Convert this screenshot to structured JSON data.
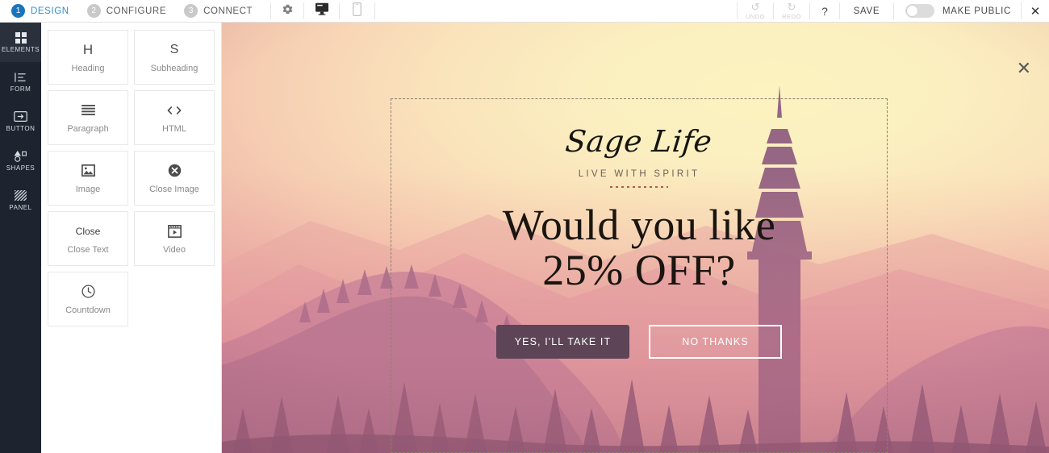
{
  "topbar": {
    "steps": [
      {
        "num": "1",
        "label": "DESIGN",
        "active": true
      },
      {
        "num": "2",
        "label": "CONFIGURE",
        "active": false
      },
      {
        "num": "3",
        "label": "CONNECT",
        "active": false
      }
    ],
    "settings_icon": "gear-icon",
    "desktop_icon": "desktop-icon",
    "mobile_icon": "mobile-icon",
    "undo_label": "UNDO",
    "redo_label": "REDO",
    "help_label": "?",
    "save_label": "SAVE",
    "make_public_label": "MAKE PUBLIC",
    "make_public_on": false,
    "close_label": "✕",
    "accent_color": "#1b75bb"
  },
  "rail": {
    "items": [
      {
        "label": "ELEMENTS",
        "icon": "grid-icon",
        "active": true
      },
      {
        "label": "FORM",
        "icon": "form-list-icon",
        "active": false
      },
      {
        "label": "BUTTON",
        "icon": "button-icon",
        "active": false
      },
      {
        "label": "SHAPES",
        "icon": "shapes-icon",
        "active": false
      },
      {
        "label": "PANEL",
        "icon": "panel-icon",
        "active": false
      }
    ],
    "background_color": "#1d2430"
  },
  "panel": {
    "cards": [
      {
        "glyph": "H",
        "label": "Heading",
        "icon": "heading-icon"
      },
      {
        "glyph": "S",
        "label": "Subheading",
        "icon": "subheading-icon"
      },
      {
        "glyph": "☰",
        "label": "Paragraph",
        "icon": "paragraph-icon"
      },
      {
        "glyph": "<>",
        "label": "HTML",
        "icon": "html-code-icon"
      },
      {
        "glyph": "Ὓc",
        "label": "Image",
        "icon": "image-icon"
      },
      {
        "glyph": "✖",
        "label": "Close Image",
        "icon": "close-image-icon"
      },
      {
        "glyph": "Close",
        "label": "Close Text",
        "icon": "close-text-icon"
      },
      {
        "glyph": "▶",
        "label": "Video",
        "icon": "video-icon"
      },
      {
        "glyph": "◴",
        "label": "Countdown",
        "icon": "countdown-clock-icon"
      }
    ]
  },
  "canvas": {
    "close_label": "✕",
    "popup": {
      "brand": "Sage Life",
      "tagline": "LIVE WITH SPIRIT",
      "headline_line1": "Would you like",
      "headline_line2": "25% OFF?",
      "primary_button": "YES, I'LL TAKE IT",
      "secondary_button": "NO THANKS",
      "primary_button_color": "#5e4457",
      "secondary_button_border": "#ffffff"
    }
  }
}
